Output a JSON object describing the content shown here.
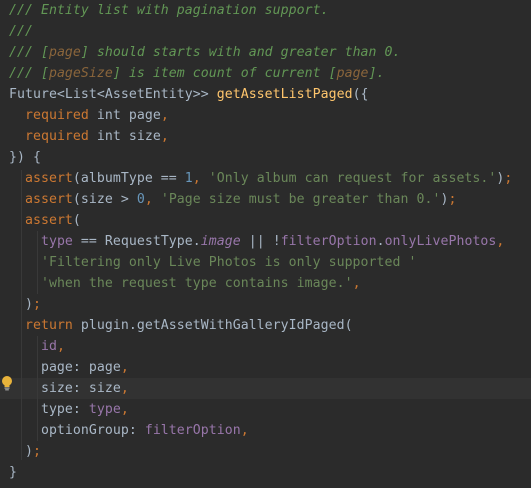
{
  "editor": {
    "current_line": 18,
    "lines": [
      [
        {
          "t": "/// Entity list with pagination support.",
          "c": "doc"
        }
      ],
      [
        {
          "t": "///",
          "c": "doc"
        }
      ],
      [
        {
          "t": "/// [",
          "c": "doc"
        },
        {
          "t": "page",
          "c": "docref"
        },
        {
          "t": "] should starts with and greater than 0.",
          "c": "doc"
        }
      ],
      [
        {
          "t": "/// [",
          "c": "doc"
        },
        {
          "t": "pageSize",
          "c": "docref"
        },
        {
          "t": "] is item count of current [",
          "c": "doc"
        },
        {
          "t": "page",
          "c": "docref"
        },
        {
          "t": "].",
          "c": "doc"
        }
      ],
      [
        {
          "t": "Future<List<AssetEntity>> ",
          "c": "plain"
        },
        {
          "t": "getAssetListPaged",
          "c": "fn"
        },
        {
          "t": "({",
          "c": "plain"
        }
      ],
      [
        {
          "t": "  ",
          "c": "plain"
        },
        {
          "t": "required",
          "c": "kw"
        },
        {
          "t": " int page",
          "c": "plain"
        },
        {
          "t": ",",
          "c": "kw"
        }
      ],
      [
        {
          "t": "  ",
          "c": "plain"
        },
        {
          "t": "required",
          "c": "kw"
        },
        {
          "t": " int size",
          "c": "plain"
        },
        {
          "t": ",",
          "c": "kw"
        }
      ],
      [
        {
          "t": "}) {",
          "c": "plain"
        }
      ],
      [
        {
          "t": "  ",
          "c": "plain"
        },
        {
          "t": "assert",
          "c": "kw"
        },
        {
          "t": "(albumType == ",
          "c": "plain"
        },
        {
          "t": "1",
          "c": "num"
        },
        {
          "t": ", ",
          "c": "kw"
        },
        {
          "t": "'Only album can request for assets.'",
          "c": "str"
        },
        {
          "t": ")",
          "c": "plain"
        },
        {
          "t": ";",
          "c": "kw"
        }
      ],
      [
        {
          "t": "  ",
          "c": "plain"
        },
        {
          "t": "assert",
          "c": "kw"
        },
        {
          "t": "(size > ",
          "c": "plain"
        },
        {
          "t": "0",
          "c": "num"
        },
        {
          "t": ", ",
          "c": "kw"
        },
        {
          "t": "'Page size must be greater than 0.'",
          "c": "str"
        },
        {
          "t": ")",
          "c": "plain"
        },
        {
          "t": ";",
          "c": "kw"
        }
      ],
      [
        {
          "t": "  ",
          "c": "plain"
        },
        {
          "t": "assert",
          "c": "kw"
        },
        {
          "t": "(",
          "c": "plain"
        }
      ],
      [
        {
          "t": "    ",
          "c": "plain"
        },
        {
          "t": "type",
          "c": "field"
        },
        {
          "t": " == RequestType.",
          "c": "plain"
        },
        {
          "t": "image",
          "c": "static"
        },
        {
          "t": " || !",
          "c": "plain"
        },
        {
          "t": "filterOption",
          "c": "field"
        },
        {
          "t": ".",
          "c": "plain"
        },
        {
          "t": "onlyLivePhotos",
          "c": "field"
        },
        {
          "t": ",",
          "c": "kw"
        }
      ],
      [
        {
          "t": "    ",
          "c": "plain"
        },
        {
          "t": "'Filtering only Live Photos is only supported '",
          "c": "str"
        }
      ],
      [
        {
          "t": "    ",
          "c": "plain"
        },
        {
          "t": "'when the request type contains image.'",
          "c": "str"
        },
        {
          "t": ",",
          "c": "kw"
        }
      ],
      [
        {
          "t": "  )",
          "c": "plain"
        },
        {
          "t": ";",
          "c": "kw"
        }
      ],
      [
        {
          "t": "  ",
          "c": "plain"
        },
        {
          "t": "return",
          "c": "kw"
        },
        {
          "t": " plugin.getAssetWithGalleryIdPaged(",
          "c": "plain"
        }
      ],
      [
        {
          "t": "    ",
          "c": "plain"
        },
        {
          "t": "id",
          "c": "field"
        },
        {
          "t": ",",
          "c": "kw"
        }
      ],
      [
        {
          "t": "    page: page",
          "c": "plain"
        },
        {
          "t": ",",
          "c": "kw"
        }
      ],
      [
        {
          "t": "    size: size",
          "c": "plain"
        },
        {
          "t": ",",
          "c": "kw"
        }
      ],
      [
        {
          "t": "    type: ",
          "c": "plain"
        },
        {
          "t": "type",
          "c": "field"
        },
        {
          "t": ",",
          "c": "kw"
        }
      ],
      [
        {
          "t": "    optionGroup: ",
          "c": "plain"
        },
        {
          "t": "filterOption",
          "c": "field"
        },
        {
          "t": ",",
          "c": "kw"
        }
      ],
      [
        {
          "t": "  )",
          "c": "plain"
        },
        {
          "t": ";",
          "c": "kw"
        }
      ],
      [
        {
          "t": "}",
          "c": "plain"
        }
      ]
    ]
  },
  "gutter": {
    "bulb_icon": "lightbulb-icon"
  },
  "theme": {
    "background": "#2b2b2b",
    "current_line": "#323232",
    "doc_comment": "#629755",
    "doc_reference": "#8a653b",
    "keyword": "#cc7832",
    "function": "#ffc66d",
    "string": "#6a8759",
    "number": "#6897bb",
    "field": "#9876aa",
    "plain": "#a9b7c6"
  }
}
